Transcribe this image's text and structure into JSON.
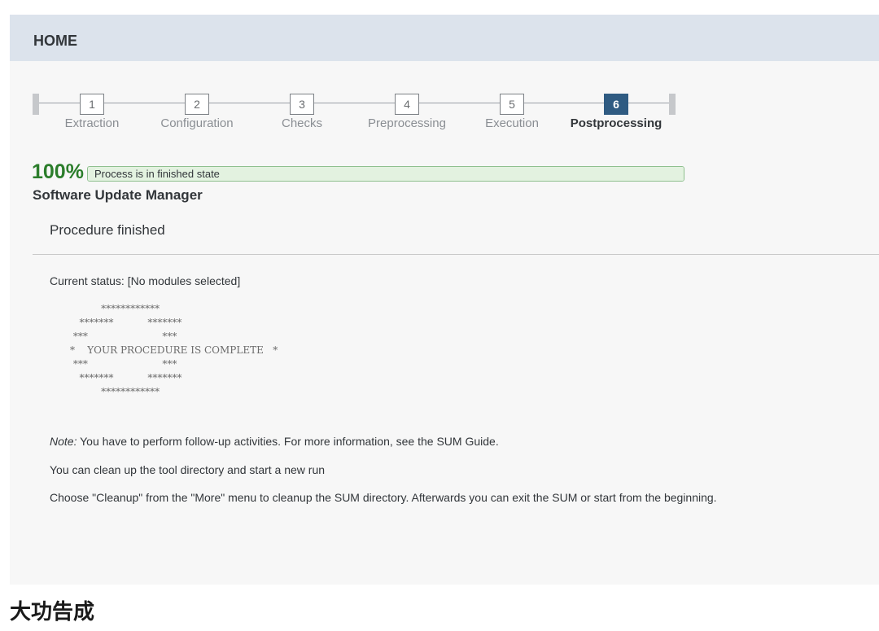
{
  "header": {
    "title": "HOME"
  },
  "steps": [
    {
      "number": "1",
      "label": "Extraction"
    },
    {
      "number": "2",
      "label": "Configuration"
    },
    {
      "number": "3",
      "label": "Checks"
    },
    {
      "number": "4",
      "label": "Preprocessing"
    },
    {
      "number": "5",
      "label": "Execution"
    },
    {
      "number": "6",
      "label": "Postprocessing",
      "active": true
    }
  ],
  "progress": {
    "percent_text": "100%",
    "value": 100,
    "status_text": "Process is in finished state"
  },
  "app": {
    "title": "Software Update Manager",
    "subtitle": "Procedure finished"
  },
  "status": {
    "current": "Current status: [No modules selected]"
  },
  "banner": {
    "lines": [
      "          ************",
      "   *******           *******",
      " ***                        ***",
      "*    YOUR PROCEDURE IS COMPLETE   *",
      " ***                        ***",
      "   *******           *******",
      "          ************"
    ]
  },
  "notes": {
    "note_label": "Note:",
    "note_text": " You have to perform follow-up activities. For more information, see the SUM Guide.",
    "cleanup_line": "You can clean up the tool directory and start a new run",
    "choose_line": "Choose \"Cleanup\" from the \"More\" menu to cleanup the SUM directory. Afterwards you can exit the SUM or start from the beginning."
  },
  "caption": "大功告成",
  "colors": {
    "header_bg": "#dce3ec",
    "active_step": "#2f5b82",
    "success": "#2b7d2b",
    "progress_fill": "#e3f2e0"
  }
}
